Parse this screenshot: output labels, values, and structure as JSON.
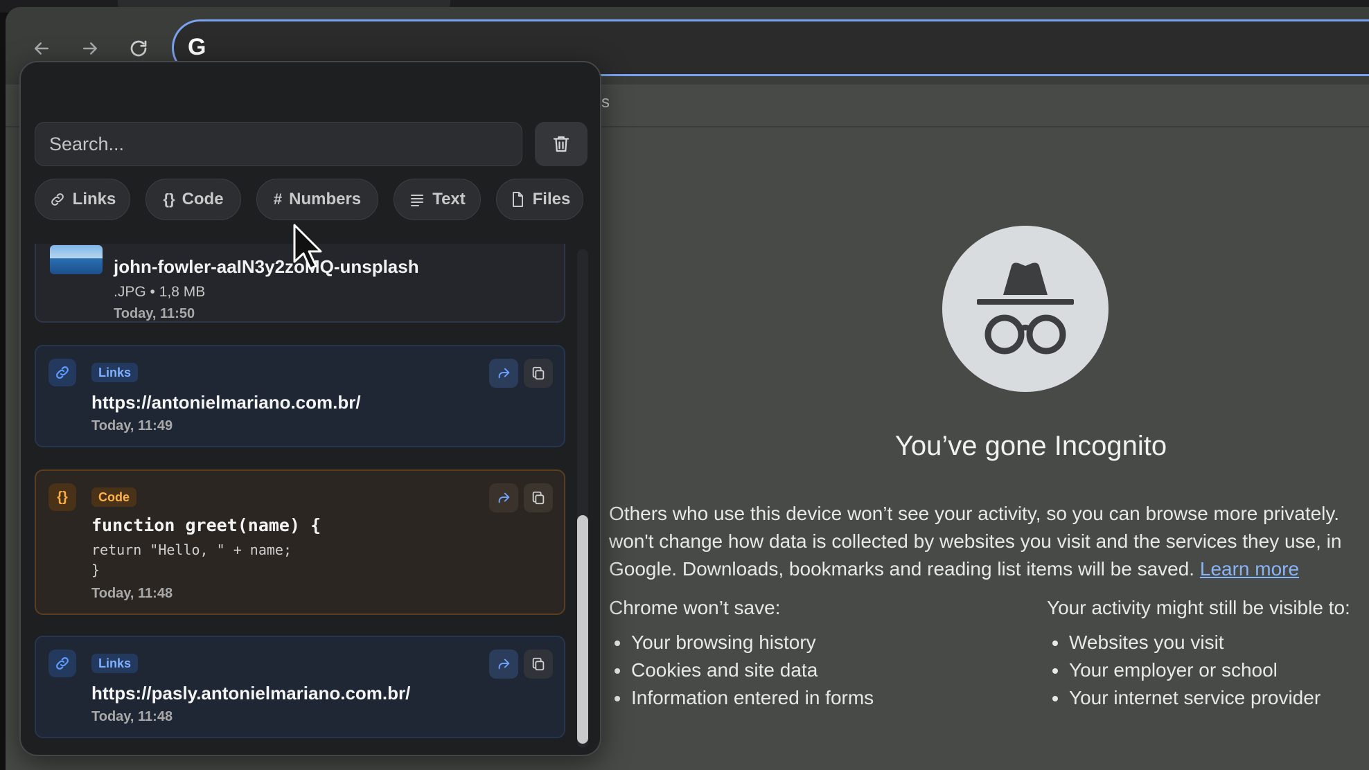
{
  "browser": {
    "omnibox_badge": "G",
    "page_tabs_fragment": "s"
  },
  "incognito": {
    "title": "You’ve gone Incognito",
    "desc_line1": "Others who use this device won’t see your activity, so you can browse more privately.",
    "desc_line2": "won't change how data is collected by websites you visit and the services they use, in",
    "desc_line3": "Google. Downloads, bookmarks and reading list items will be saved.",
    "learn_more": "Learn more",
    "wont_save_title": "Chrome won’t save:",
    "wont_save": [
      "Your browsing history",
      "Cookies and site data",
      "Information entered in forms"
    ],
    "visible_title": "Your activity might still be visible to:",
    "visible": [
      "Websites you visit",
      "Your employer or school",
      "Your internet service provider"
    ]
  },
  "panel": {
    "search_placeholder": "Search...",
    "filters": [
      {
        "label": "Links",
        "icon": "link-icon"
      },
      {
        "label": "Code",
        "icon": "braces-icon"
      },
      {
        "label": "Numbers",
        "icon": "hash-icon"
      },
      {
        "label": "Text",
        "icon": "lines-icon"
      },
      {
        "label": "Files",
        "icon": "file-icon"
      }
    ],
    "items": [
      {
        "type": "file",
        "name": "john-fowler-aaIN3y2zoMQ-unsplash",
        "meta": ".JPG • 1,8 MB",
        "time": "Today, 11:50"
      },
      {
        "type": "links",
        "badge": "Links",
        "content": "https://antonielmariano.com.br/",
        "time": "Today, 11:49"
      },
      {
        "type": "code",
        "badge": "Code",
        "line1": "function greet(name) {",
        "rest": "return \"Hello, \" + name;\n}",
        "time": "Today, 11:48"
      },
      {
        "type": "links",
        "badge": "Links",
        "content": "https://pasly.antonielmariano.com.br/",
        "time": "Today, 11:48"
      }
    ]
  },
  "colors": {
    "accent_blue": "#5d9bff",
    "code_orange": "#ffae3d",
    "omnibox_focus": "#7ba2f0",
    "page_bg": "#474a47",
    "panel_bg": "#1e1f21"
  }
}
